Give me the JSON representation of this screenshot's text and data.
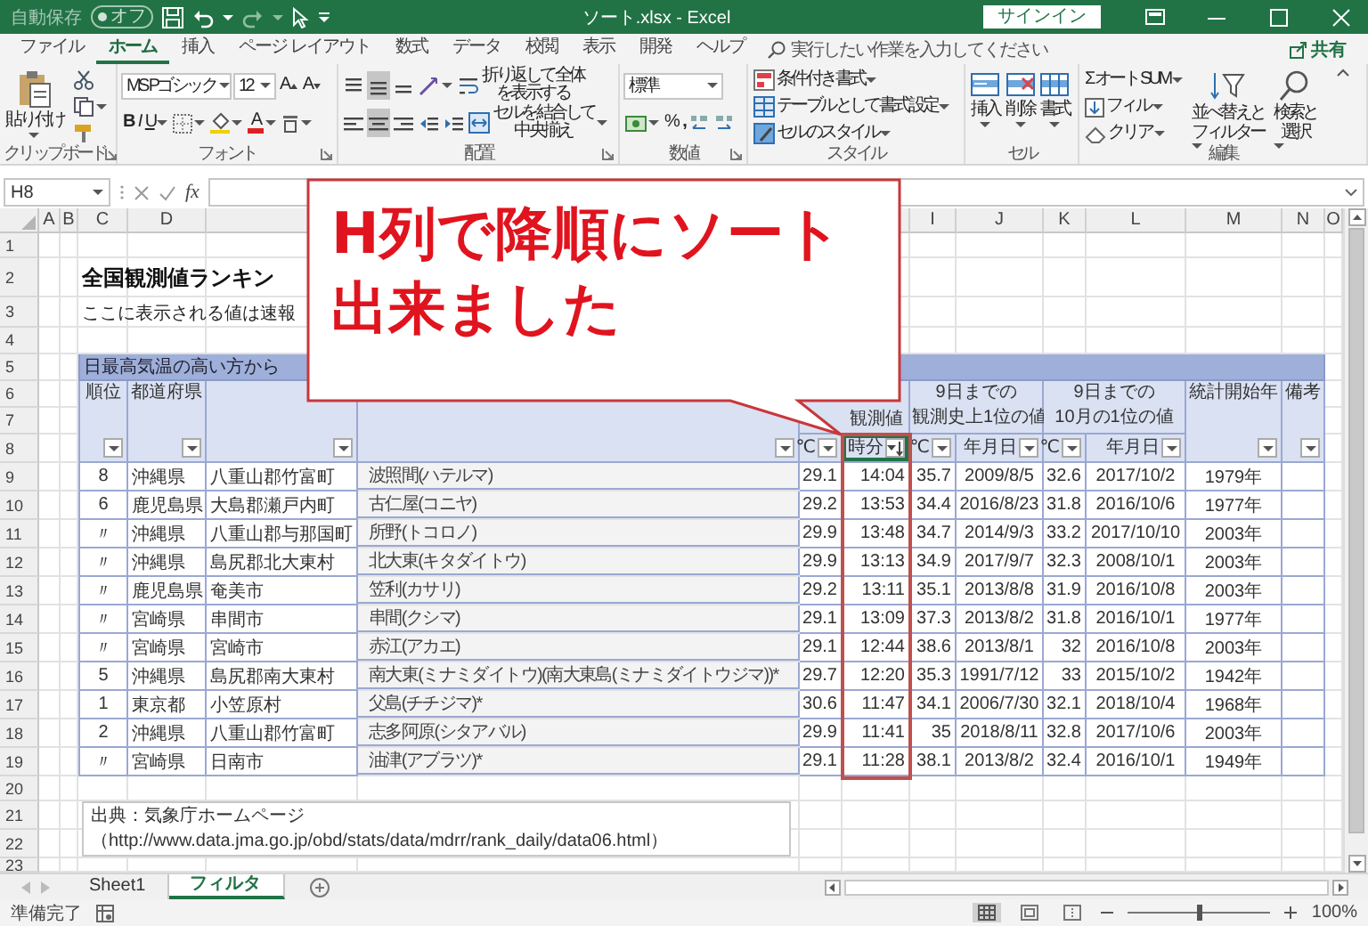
{
  "title_bar": {
    "autosave_label": "自動保存",
    "autosave": {
      "label": "オフ",
      "on": false
    },
    "title": "ソート.xlsx - Excel",
    "sign_in": "サインイン"
  },
  "tabs": [
    {
      "label": "ファイル",
      "selected": false
    },
    {
      "label": "ホーム",
      "selected": true
    },
    {
      "label": "挿入",
      "selected": false
    },
    {
      "label": "ページ レイアウト",
      "selected": false
    },
    {
      "label": "数式",
      "selected": false
    },
    {
      "label": "データ",
      "selected": false
    },
    {
      "label": "校閲",
      "selected": false
    },
    {
      "label": "表示",
      "selected": false
    },
    {
      "label": "開発",
      "selected": false
    },
    {
      "label": "ヘルプ",
      "selected": false
    }
  ],
  "tell_me": "実行したい作業を入力してください",
  "share": "共有",
  "ribbon": {
    "groups": [
      {
        "kind": "clipboard",
        "label": "クリップボード",
        "launcher": true,
        "paste": "貼り付け"
      },
      {
        "kind": "font",
        "label": "フォント",
        "launcher": true,
        "font_name": "MS Pゴシック",
        "font_size": "12",
        "grow": "A",
        "shrink": "A",
        "bold": "B",
        "italic": "I",
        "underline": "U",
        "font_color": "A"
      },
      {
        "kind": "alignment",
        "label": "配置",
        "launcher": true,
        "vertical": [
          {
            "selected": false
          },
          {
            "selected": true
          },
          {
            "selected": false
          }
        ],
        "horizontal": [
          {
            "selected": false
          },
          {
            "selected": true
          },
          {
            "selected": false
          }
        ],
        "wrap": "折り返して全体を表示する",
        "merge": "セルを結合して中央揃え"
      },
      {
        "kind": "number",
        "label": "数値",
        "launcher": true,
        "format": "標準",
        "percent": "%",
        "comma": ","
      },
      {
        "kind": "styles",
        "label": "スタイル",
        "launcher": false,
        "buttons": [
          "条件付き書式",
          "テーブルとして書式設定",
          "セルのスタイル"
        ]
      },
      {
        "kind": "cells",
        "label": "セル",
        "launcher": false,
        "buttons": [
          "挿入",
          "削除",
          "書式"
        ]
      },
      {
        "kind": "editing",
        "label": "編集",
        "launcher": false,
        "sum_symbol": "Σ",
        "autosum": "オート SUM",
        "fill": "フィル",
        "clear": "クリア",
        "sort": [
          "並べ替えと",
          "フィルター"
        ],
        "find": [
          "検索と",
          "選択"
        ]
      }
    ]
  },
  "formula_bar": {
    "name_box": "H8",
    "function_label": "fx"
  },
  "sheet": {
    "column_headers": {
      "left": [
        "A",
        "B",
        "C",
        "D"
      ],
      "right": [
        "I",
        "J",
        "K",
        "L",
        "M",
        "N",
        "O"
      ]
    },
    "row_numbers": [
      "1",
      "2",
      "3",
      "4",
      "5",
      "6",
      "7",
      "8",
      "9",
      "10",
      "11",
      "12",
      "13",
      "14",
      "15",
      "16",
      "17",
      "18",
      "19",
      "20",
      "21",
      "22",
      "23"
    ],
    "title": "全国観測値ランキン",
    "note": "ここに表示される値は速報",
    "band": "日最高気温の高い方から",
    "headers": {
      "rank": "順位",
      "prefecture": "都道府県",
      "observed": "観測値",
      "record": [
        "9日までの",
        "観測史上1位の値"
      ],
      "october": [
        "9日までの",
        "10月の1位の値"
      ],
      "start_year": "統計開始年",
      "remarks": "備考"
    },
    "filters": [
      {
        "sorted": false,
        "selected": false
      },
      {
        "sorted": false,
        "selected": false
      },
      {
        "sorted": false,
        "selected": false
      },
      {
        "sorted": false,
        "selected": false
      },
      {
        "label": "℃",
        "sorted": false,
        "selected": false
      },
      {
        "label": "時分",
        "sorted": true,
        "selected": true
      },
      {
        "label": "℃",
        "sorted": false,
        "selected": false
      },
      {
        "label": "年月日",
        "sorted": false,
        "selected": false
      },
      {
        "label": "℃",
        "sorted": false,
        "selected": false
      },
      {
        "label": "年月日",
        "sorted": false,
        "selected": false
      },
      {
        "sorted": false,
        "selected": false
      },
      {
        "sorted": false,
        "selected": false
      }
    ],
    "rows": [
      {
        "rank": "8",
        "prefecture": "沖縄県",
        "municipality": "八重山郡竹富町",
        "station": "波照間(ハテルマ)",
        "temp": "29.1",
        "time": "14:04",
        "record_temp": "35.7",
        "record_date": "2009/8/5",
        "oct_temp": "32.6",
        "oct_date": "2017/10/2",
        "start_year": "1979年"
      },
      {
        "rank": "6",
        "prefecture": "鹿児島県",
        "municipality": "大島郡瀬戸内町",
        "station": "古仁屋(コニヤ)",
        "temp": "29.2",
        "time": "13:53",
        "record_temp": "34.4",
        "record_date": "2016/8/23",
        "oct_temp": "31.8",
        "oct_date": "2016/10/6",
        "start_year": "1977年"
      },
      {
        "rank": "〃",
        "prefecture": "沖縄県",
        "municipality": "八重山郡与那国町",
        "station": "所野(トコロノ)",
        "temp": "29.9",
        "time": "13:48",
        "record_temp": "34.7",
        "record_date": "2014/9/3",
        "oct_temp": "33.2",
        "oct_date": "2017/10/10",
        "start_year": "2003年"
      },
      {
        "rank": "〃",
        "prefecture": "沖縄県",
        "municipality": "島尻郡北大東村",
        "station": "北大東(キタダイトウ)",
        "temp": "29.9",
        "time": "13:13",
        "record_temp": "34.9",
        "record_date": "2017/9/7",
        "oct_temp": "32.3",
        "oct_date": "2008/10/1",
        "start_year": "2003年"
      },
      {
        "rank": "〃",
        "prefecture": "鹿児島県",
        "municipality": "奄美市",
        "station": "笠利(カサリ)",
        "temp": "29.2",
        "time": "13:11",
        "record_temp": "35.1",
        "record_date": "2013/8/8",
        "oct_temp": "31.9",
        "oct_date": "2016/10/8",
        "start_year": "2003年"
      },
      {
        "rank": "〃",
        "prefecture": "宮崎県",
        "municipality": "串間市",
        "station": "串間(クシマ)",
        "temp": "29.1",
        "time": "13:09",
        "record_temp": "37.3",
        "record_date": "2013/8/2",
        "oct_temp": "31.8",
        "oct_date": "2016/10/1",
        "start_year": "1977年"
      },
      {
        "rank": "〃",
        "prefecture": "宮崎県",
        "municipality": "宮崎市",
        "station": "赤江(アカエ)",
        "temp": "29.1",
        "time": "12:44",
        "record_temp": "38.6",
        "record_date": "2013/8/1",
        "oct_temp": "32",
        "oct_date": "2016/10/8",
        "start_year": "2003年"
      },
      {
        "rank": "5",
        "prefecture": "沖縄県",
        "municipality": "島尻郡南大東村",
        "station": "南大東(ミナミダイトウ)(南大東島(ミナミダイトウジマ))*",
        "temp": "29.7",
        "time": "12:20",
        "record_temp": "35.3",
        "record_date": "1991/7/12",
        "oct_temp": "33",
        "oct_date": "2015/10/2",
        "start_year": "1942年"
      },
      {
        "rank": "1",
        "prefecture": "東京都",
        "municipality": "小笠原村",
        "station": "父島(チチジマ)*",
        "temp": "30.6",
        "time": "11:47",
        "record_temp": "34.1",
        "record_date": "2006/7/30",
        "oct_temp": "32.1",
        "oct_date": "2018/10/4",
        "start_year": "1968年"
      },
      {
        "rank": "2",
        "prefecture": "沖縄県",
        "municipality": "八重山郡竹富町",
        "station": "志多阿原(シタアバル)",
        "temp": "29.9",
        "time": "11:41",
        "record_temp": "35",
        "record_date": "2018/8/11",
        "oct_temp": "32.8",
        "oct_date": "2017/10/6",
        "start_year": "2003年"
      },
      {
        "rank": "〃",
        "prefecture": "宮崎県",
        "municipality": "日南市",
        "station": "油津(アブラツ)*",
        "temp": "29.1",
        "time": "11:28",
        "record_temp": "38.1",
        "record_date": "2013/8/2",
        "oct_temp": "32.4",
        "oct_date": "2016/10/1",
        "start_year": "1949年"
      }
    ],
    "source": [
      "出典：気象庁ホームページ",
      "（http://www.data.jma.go.jp/obd/stats/data/mdrr/rank_daily/data06.html）"
    ]
  },
  "callout": {
    "lines": [
      "H列で降順にソート",
      "出来ました"
    ]
  },
  "sheet_tabs": [
    {
      "label": "Sheet1",
      "selected": false
    },
    {
      "label": "フィルタ",
      "selected": true
    }
  ],
  "status_bar": {
    "text": "準備完了",
    "zoom_slider": {
      "level": 0.5
    },
    "zoom": "100%"
  }
}
